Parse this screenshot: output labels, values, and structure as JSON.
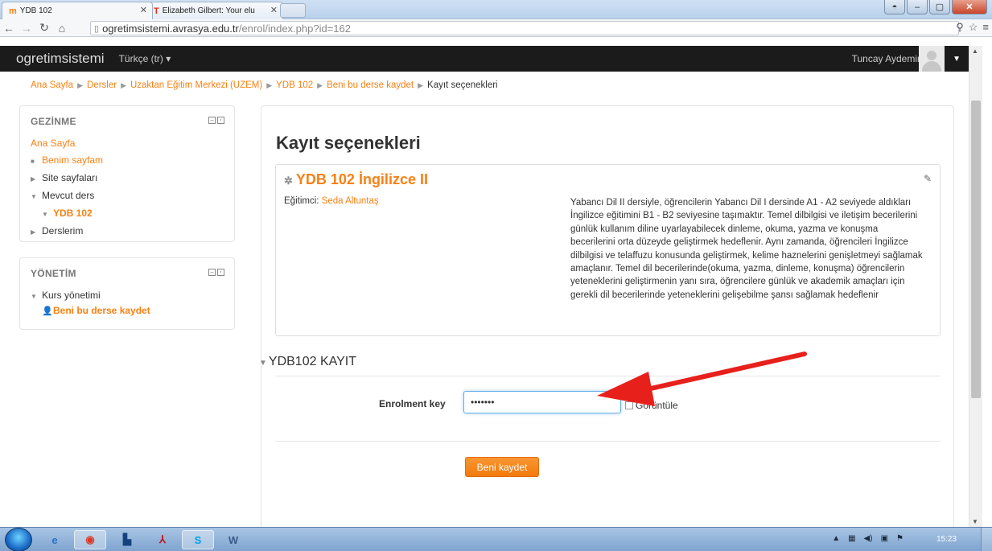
{
  "browser": {
    "tabs": [
      {
        "label": "YDB 102",
        "favicon": "m"
      },
      {
        "label": "Elizabeth Gilbert: Your elu",
        "favicon": "T"
      }
    ],
    "url_host": "ogretimsistemi.avrasya.edu.tr",
    "url_path": "/enrol/index.php?id=162"
  },
  "navbar": {
    "brand": "ogretimsistemi",
    "language": "Türkçe (tr) ▾",
    "user_name": "Tuncay Aydemir"
  },
  "breadcrumb": [
    "Ana Sayfa",
    "Dersler",
    "Uzaktan Eğitim Merkezi (UZEM)",
    "YDB 102",
    "Beni bu derse kaydet",
    "Kayıt seçenekleri"
  ],
  "navigation_block": {
    "title": "GEZİNME",
    "items": [
      {
        "label": "Ana Sayfa"
      },
      {
        "label": "Benim sayfam"
      },
      {
        "label": "Site sayfaları"
      },
      {
        "label": "Mevcut ders"
      },
      {
        "label": "YDB 102"
      },
      {
        "label": "Derslerim"
      }
    ]
  },
  "admin_block": {
    "title": "YÖNETİM",
    "items": [
      {
        "label": "Kurs yönetimi"
      },
      {
        "label": "Beni bu derse kaydet"
      }
    ]
  },
  "main": {
    "title": "Kayıt seçenekleri",
    "course_name": "YDB 102 İngilizce II",
    "teacher_label": "Eğitimci: ",
    "teacher_name": "Seda Altuntaş",
    "summary": "Yabancı Dil II dersiyle, öğrencilerin Yabancı Dil I dersinde A1 - A2 seviyede aldıkları İngilizce eğitimini B1 - B2 seviyesine taşımaktır. Temel dilbilgisi ve iletişim becerilerini günlük kullanım diline uyarlayabilecek dinleme, okuma, yazma ve konuşma becerilerini orta düzeyde geliştirmek hedeflenir. Aynı zamanda, öğrencileri İngilizce dilbilgisi ve telaffuzu konusunda geliştirmek, kelime haznelerini genişletmeyi sağlamak amaçlanır. Temel dil becerilerinde(okuma, yazma, dinleme, konuşma) öğrencilerin yeteneklerini geliştirmenin yanı sıra, öğrencilere günlük ve akademik amaçları için gerekli dil becerilerinde yeteneklerini gelişebilme şansı sağlamak hedeflenir",
    "form_legend": "YDB102 KAYIT",
    "key_label": "Enrolment key",
    "key_value": "•••••••",
    "show_label": "Görüntüle",
    "submit_label": "Beni kaydet"
  },
  "taskbar": {
    "clock": "15:23"
  },
  "colors": {
    "accent": "#f98012",
    "navbar": "#1b1b1b",
    "arrow": "#e8201c"
  }
}
